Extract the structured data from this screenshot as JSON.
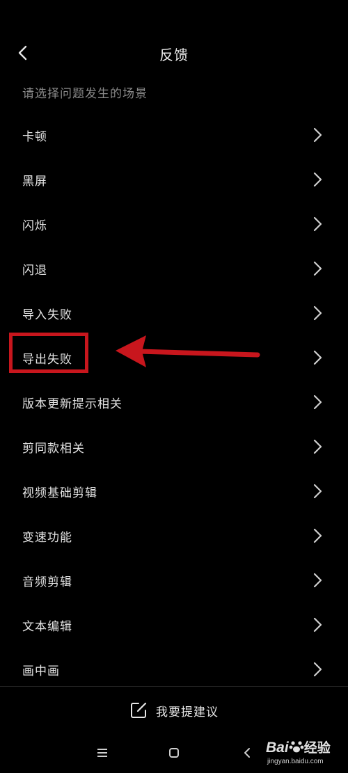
{
  "header": {
    "title": "反馈",
    "back_icon": "chevron-left-icon"
  },
  "subtitle": "请选择问题发生的场景",
  "items": [
    {
      "label": "卡顿"
    },
    {
      "label": "黑屏"
    },
    {
      "label": "闪烁"
    },
    {
      "label": "闪退"
    },
    {
      "label": "导入失败"
    },
    {
      "label": "导出失败"
    },
    {
      "label": "版本更新提示相关"
    },
    {
      "label": "剪同款相关"
    },
    {
      "label": "视频基础剪辑"
    },
    {
      "label": "变速功能"
    },
    {
      "label": "音频剪辑"
    },
    {
      "label": "文本编辑"
    },
    {
      "label": "画中画"
    }
  ],
  "suggestion": {
    "label": "我要提建议",
    "icon": "edit-icon"
  },
  "navbar": {
    "icons": [
      "menu-icon",
      "home-square-icon",
      "back-icon"
    ]
  },
  "annotation": {
    "highlight_color": "#c8161d",
    "highlighted_item": "导出失败"
  },
  "watermark": {
    "brand": "Bai",
    "suffix": "经验",
    "url": "jingyan.baidu.com"
  }
}
